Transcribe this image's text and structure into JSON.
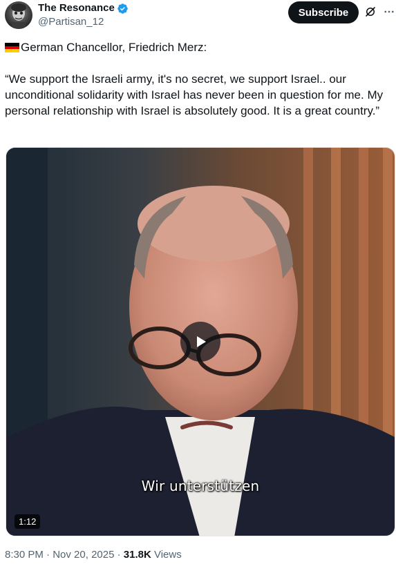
{
  "author": {
    "display_name": "The Resonance",
    "handle": "@Partisan_12",
    "verified": true,
    "verified_color": "#1d9bf0"
  },
  "header": {
    "subscribe_label": "Subscribe",
    "grok_icon": "grok-slash-icon",
    "more_icon": "more-dots-icon"
  },
  "post": {
    "flag": "german-flag-emoji",
    "intro": "German Chancellor, Friedrich Merz:",
    "quote": "“We support the Israeli army, it's no secret, we support Israel.. our unconditional solidarity with Israel has never been in question for me. My personal relationship with Israel is absolutely good. It is a great country.”"
  },
  "media": {
    "subtitle": "Wir unterstützen",
    "duration": "1:12",
    "play_icon": "play-icon"
  },
  "meta": {
    "time": "8:30 PM",
    "separator": " · ",
    "date": "Nov 20, 2025",
    "views_count": "31.8K",
    "views_label": " Views"
  }
}
